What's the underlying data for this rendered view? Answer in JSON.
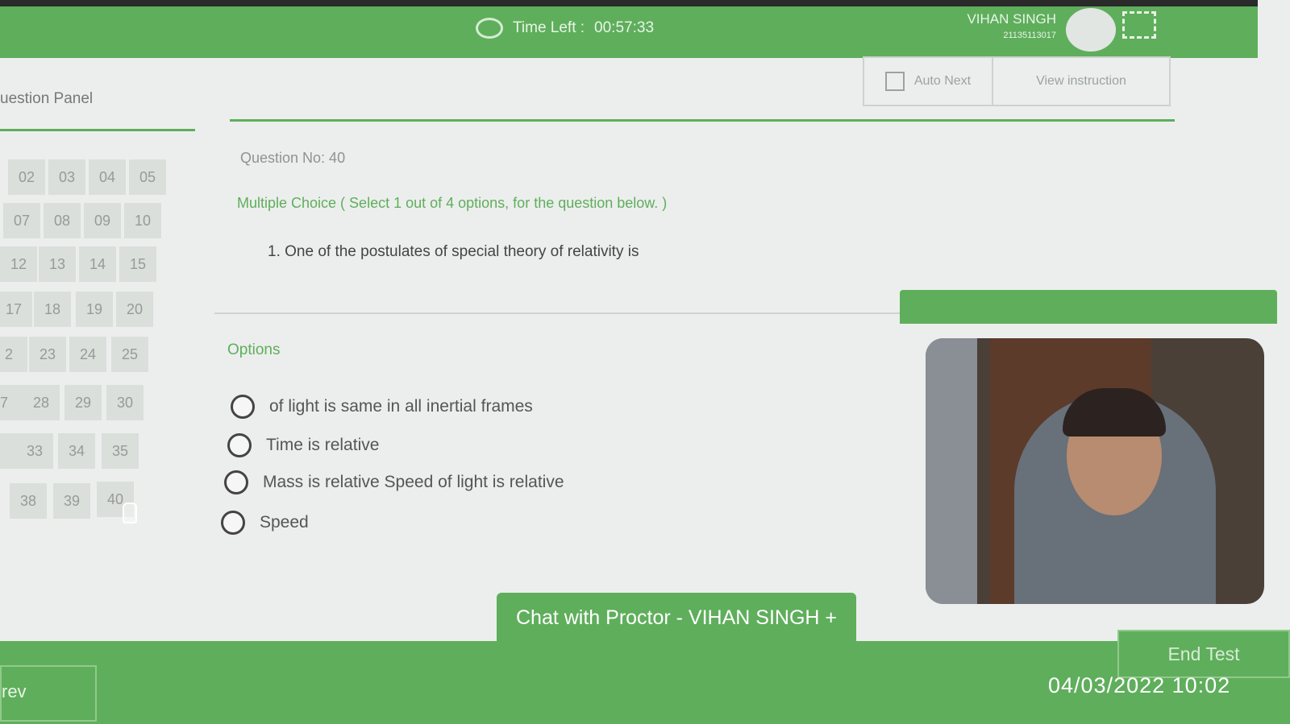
{
  "header": {
    "time_left_label": "Time Left :",
    "time_left_value": "00:57:33",
    "user_name": "VIHAN SINGH",
    "user_id": "21135113017"
  },
  "question_panel": {
    "title": "uestion Panel",
    "numbers": [
      "02",
      "03",
      "04",
      "05",
      "07",
      "08",
      "09",
      "10",
      "12",
      "13",
      "14",
      "15",
      "17",
      "18",
      "19",
      "20",
      "2",
      "23",
      "24",
      "25",
      "7",
      "28",
      "29",
      "30",
      "",
      "33",
      "34",
      "35",
      "38",
      "39",
      "40"
    ]
  },
  "controls": {
    "auto_next_label": "Auto Next",
    "view_instruction_label": "View instruction"
  },
  "question": {
    "number_label": "Question No: 40",
    "type_label": "Multiple Choice ( Select 1 out of 4 options, for the question below. )",
    "text": "1. One of the postulates of special theory of relativity is"
  },
  "options": {
    "label": "Options",
    "items": [
      "of light is same in all inertial frames",
      "Time is relative",
      "Mass is relative Speed of light is relative",
      "Speed"
    ]
  },
  "chat": {
    "label": "Chat with Proctor - VIHAN SINGH +"
  },
  "footer": {
    "prev_label": "rev",
    "end_test_label": "End Test"
  },
  "photo_timestamp": "04/03/2022 10:02",
  "colors": {
    "accent": "#5fae5c"
  }
}
